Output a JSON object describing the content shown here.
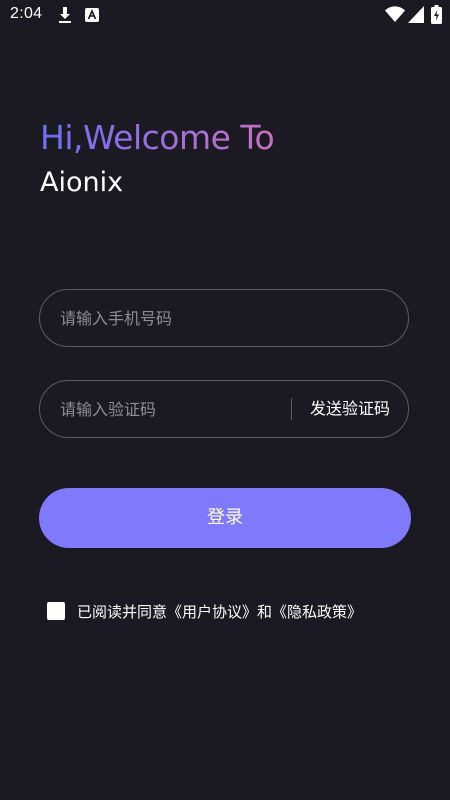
{
  "status_bar": {
    "time": "2:04",
    "icons": [
      "download-icon",
      "notification-app-icon",
      "wifi-icon",
      "signal-icon",
      "battery-charging-icon"
    ]
  },
  "header": {
    "welcome": "Hi,Welcome To",
    "app_name": "Aionix"
  },
  "form": {
    "phone_placeholder": "请输入手机号码",
    "code_placeholder": "请输入验证码",
    "send_code_label": "发送验证码",
    "login_label": "登录"
  },
  "agreement": {
    "prefix": "已阅读并同意",
    "user_agreement": "《用户协议》",
    "conjunction": "和",
    "privacy_policy": "《隐私政策》",
    "checked": false
  },
  "colors": {
    "background": "#1b1a22",
    "accent": "#7f79fc",
    "title_gradient_start": "#6f6ff6",
    "title_gradient_end": "#c770c2"
  }
}
